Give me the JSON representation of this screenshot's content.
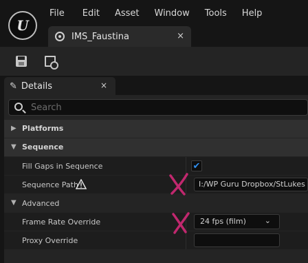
{
  "menu": [
    "File",
    "Edit",
    "Asset",
    "Window",
    "Tools",
    "Help"
  ],
  "logo_text": "U",
  "document_tab": {
    "label": "IMS_Faustina",
    "close": "×"
  },
  "toolbar": {
    "save_icon": "save-icon",
    "browse_icon": "browse-icon"
  },
  "panel": {
    "title": "Details",
    "close": "×"
  },
  "search": {
    "placeholder": "Search",
    "value": ""
  },
  "categories": {
    "platforms": {
      "label": "Platforms",
      "expanded": false
    },
    "sequence": {
      "label": "Sequence",
      "expanded": true
    },
    "advanced": {
      "label": "Advanced",
      "expanded": true
    }
  },
  "arrows": {
    "collapsed": "▶",
    "expanded": "▼"
  },
  "properties": {
    "fill_gaps": {
      "label": "Fill Gaps in Sequence",
      "checked": true,
      "check_glyph": "✔"
    },
    "sequence_path": {
      "label": "Sequence Path",
      "value": "I:/WP Guru Dropbox/StLukes"
    },
    "frame_rate": {
      "label": "Frame Rate Override",
      "value": "24 fps (film)",
      "chevron": "⌄"
    },
    "proxy": {
      "label": "Proxy Override",
      "value": ""
    }
  },
  "colors": {
    "accent": "#2f8ff0",
    "annotation": "#c0286e",
    "warning": "#e0e0e0"
  }
}
